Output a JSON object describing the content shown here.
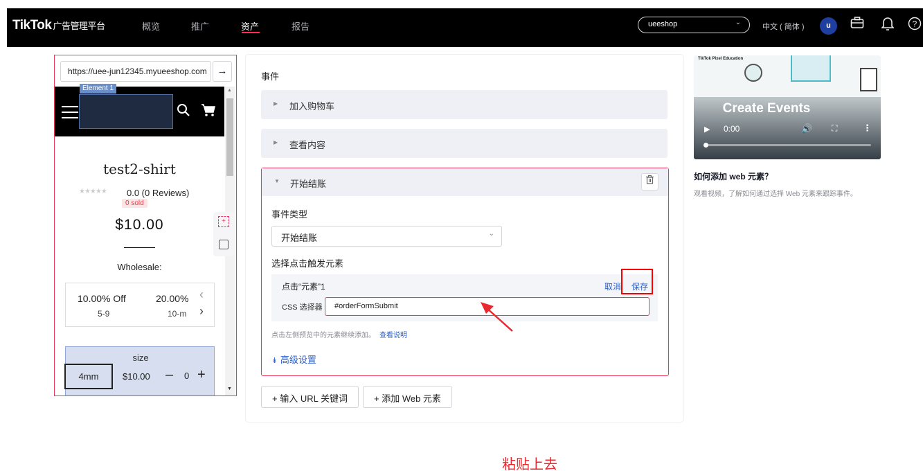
{
  "header": {
    "logo": "TikTok",
    "logo_sub": "广告管理平台",
    "nav": [
      "概览",
      "推广",
      "资产",
      "报告"
    ],
    "active_nav": "资产",
    "account": "ueeshop",
    "language": "中文 ( 简体 )",
    "avatar_letter": "u"
  },
  "preview": {
    "url": "https://uee-jun12345.myueeshop.com",
    "element_tag": "Element 1",
    "product_title": "test2-shirt",
    "rating": "0.0 (0 Reviews)",
    "sold": "0 sold",
    "price": "$10.00",
    "wholesale_label": "Wholesale:",
    "tiers": [
      {
        "discount": "10.00% Off",
        "range": "5-9"
      },
      {
        "discount": "20.00%",
        "range": "10-m"
      }
    ],
    "size_label": "size",
    "size_option": "4mm",
    "size_price": "$10.00",
    "qty": "0"
  },
  "events": {
    "section_title": "事件",
    "items": [
      "加入购物车",
      "查看内容"
    ],
    "open_item": "开始结账",
    "event_type_label": "事件类型",
    "event_type_value": "开始结账",
    "trigger_label": "选择点击触发元素",
    "element_name": "点击“元素”1",
    "cancel": "取消",
    "save": "保存",
    "css_label": "CSS 选择器",
    "css_value": "#orderFormSubmit",
    "hint": "点击左侧预览中的元素继续添加。",
    "hint_link": "查看说明",
    "advanced": "高级设置",
    "annotation": "粘贴上去",
    "btn_url": "+ 输入 URL 关键词",
    "btn_web": "+ 添加 Web 元素"
  },
  "help": {
    "video_small_title": "TikTok Pixel Education",
    "video_title": "Create Events",
    "video_time": "0:00",
    "title": "如何添加 web 元素？",
    "desc": "观看视频，了解如何通过选择 Web 元素来跟踪事件。"
  }
}
